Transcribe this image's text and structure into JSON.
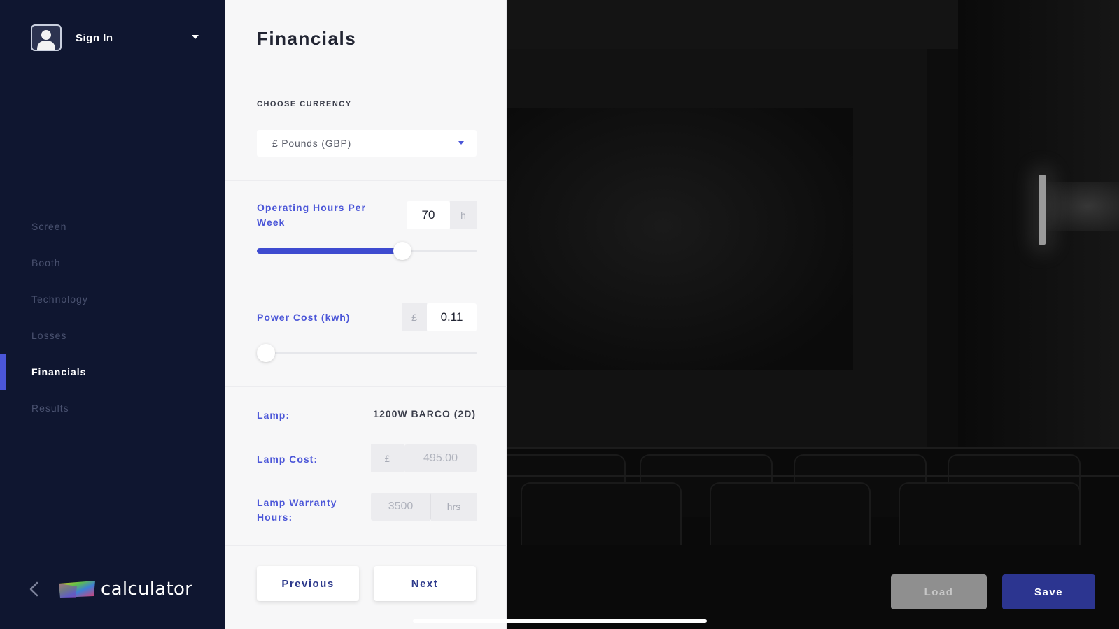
{
  "sidebar": {
    "signin_label": "Sign In",
    "nav": [
      {
        "label": "Screen",
        "active": false
      },
      {
        "label": "Booth",
        "active": false
      },
      {
        "label": "Technology",
        "active": false
      },
      {
        "label": "Losses",
        "active": false
      },
      {
        "label": "Financials",
        "active": true
      },
      {
        "label": "Results",
        "active": false
      }
    ],
    "logo_text": "calculator"
  },
  "panel": {
    "title": "Financials",
    "currency": {
      "label": "CHOOSE CURRENCY",
      "selected": "£ Pounds (GBP)"
    },
    "operating_hours": {
      "label": "Operating Hours Per Week",
      "value": "70",
      "unit": "h",
      "slider_fraction": 0.65
    },
    "power_cost": {
      "label": "Power Cost (kwh)",
      "currency_symbol": "£",
      "value": "0.11",
      "slider_fraction": 0.02
    },
    "lamp": {
      "label": "Lamp:",
      "value": "1200W BARCO (2D)"
    },
    "lamp_cost": {
      "label": "Lamp Cost:",
      "currency_symbol": "£",
      "value": "495.00"
    },
    "lamp_warranty": {
      "label": "Lamp Warranty Hours:",
      "value": "3500",
      "unit": "hrs"
    },
    "previous_label": "Previous",
    "next_label": "Next"
  },
  "preview": {
    "load_label": "Load",
    "save_label": "Save"
  },
  "colors": {
    "sidebar_bg": "#0f1630",
    "accent": "#4b56d8",
    "save_button": "#2c3590",
    "load_button": "#8f8f8f"
  }
}
